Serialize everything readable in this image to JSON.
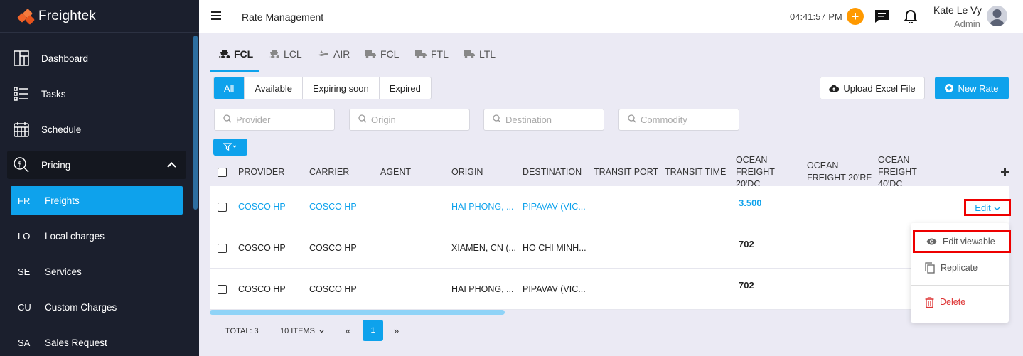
{
  "app": {
    "brand": "Freightek"
  },
  "sidebar": {
    "items": [
      {
        "label": "Dashboard",
        "icon": "dashboard-icon"
      },
      {
        "label": "Tasks",
        "icon": "tasks-icon"
      },
      {
        "label": "Schedule",
        "icon": "calendar-icon"
      },
      {
        "label": "Pricing",
        "icon": "pricing-icon",
        "expanded": true
      }
    ],
    "sub_items": [
      {
        "abbr": "FR",
        "label": "Freights",
        "active": true
      },
      {
        "abbr": "LO",
        "label": "Local charges"
      },
      {
        "abbr": "SE",
        "label": "Services"
      },
      {
        "abbr": "CU",
        "label": "Custom Charges"
      },
      {
        "abbr": "SA",
        "label": "Sales Request"
      }
    ]
  },
  "header": {
    "title": "Rate Management",
    "clock": "04:41:57 PM",
    "user_name": "Kate Le Vy",
    "user_role": "Admin"
  },
  "tabs": [
    {
      "label": "FCL",
      "icon": "ship-icon",
      "active": true
    },
    {
      "label": "LCL",
      "icon": "ship-icon"
    },
    {
      "label": "AIR",
      "icon": "plane-icon"
    },
    {
      "label": "FCL",
      "icon": "truck-icon"
    },
    {
      "label": "FTL",
      "icon": "truck-icon"
    },
    {
      "label": "LTL",
      "icon": "truck-icon"
    }
  ],
  "status_filter": {
    "options": [
      "All",
      "Available",
      "Expiring soon",
      "Expired"
    ],
    "selected": "All"
  },
  "actions": {
    "upload_label": "Upload Excel File",
    "new_rate_label": "New Rate"
  },
  "search": {
    "provider_placeholder": "Provider",
    "origin_placeholder": "Origin",
    "destination_placeholder": "Destination",
    "commodity_placeholder": "Commodity"
  },
  "table": {
    "columns": [
      "PROVIDER",
      "CARRIER",
      "AGENT",
      "ORIGIN",
      "DESTINATION",
      "TRANSIT PORT",
      "TRANSIT TIME",
      "OCEAN FREIGHT 20'DC",
      "OCEAN FREIGHT 20'RF",
      "OCEAN FREIGHT 40'DC"
    ],
    "rows": [
      {
        "provider": "COSCO HP",
        "carrier": "COSCO HP",
        "agent": "",
        "origin": "HAI PHONG, ...",
        "destination": "PIPAVAV (VIC...",
        "transit_port": "",
        "transit_time": "",
        "of20dc": "3.500",
        "of20rf": "",
        "of40dc": "",
        "linked": true
      },
      {
        "provider": "COSCO HP",
        "carrier": "COSCO HP",
        "agent": "",
        "origin": "XIAMEN, CN (...",
        "destination": "HO CHI MINH...",
        "transit_port": "",
        "transit_time": "",
        "of20dc": "702",
        "of20rf": "",
        "of40dc": "",
        "linked": false
      },
      {
        "provider": "COSCO HP",
        "carrier": "COSCO HP",
        "agent": "",
        "origin": "HAI PHONG, ...",
        "destination": "PIPAVAV (VIC...",
        "transit_port": "",
        "transit_time": "",
        "of20dc": "702",
        "of20rf": "",
        "of40dc": "",
        "linked": false
      }
    ],
    "row_action_label": "Edit"
  },
  "row_menu": {
    "items": [
      {
        "label": "Edit viewable",
        "icon": "eye-icon"
      },
      {
        "label": "Replicate",
        "icon": "copy-icon"
      },
      {
        "label": "Delete",
        "icon": "trash-icon",
        "danger": true
      }
    ]
  },
  "pagination": {
    "total": "TOTAL: 3",
    "page_size": "10 ITEMS",
    "prev": "«",
    "current": "1",
    "next": "»"
  },
  "colors": {
    "accent": "#0ea2ec",
    "sidebar_bg": "#1b1f2d",
    "brand_orange": "#f0642a",
    "highlight_red": "#e00000",
    "page_bg": "#ebeaf4"
  }
}
